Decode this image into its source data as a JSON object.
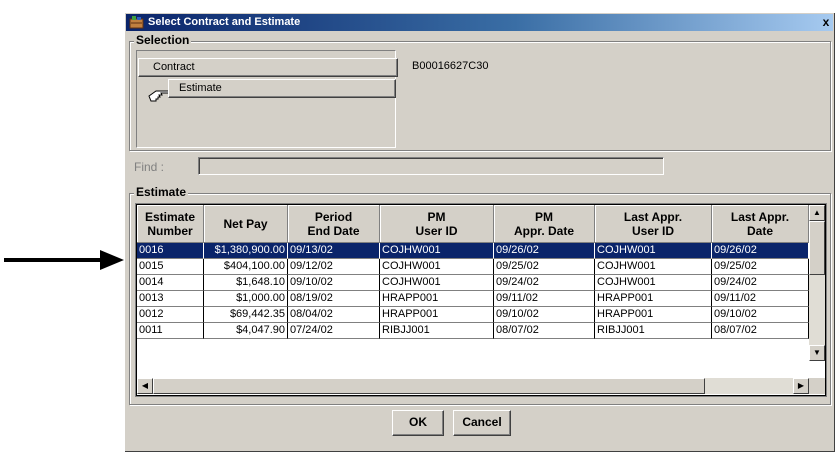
{
  "dialog": {
    "title": "Select Contract and Estimate",
    "close_label": "x"
  },
  "selection": {
    "group_label": "Selection",
    "contract_button": "Contract",
    "contract_value": "B00016627C30",
    "estimate_button": "Estimate"
  },
  "find": {
    "label": "Find :",
    "value": ""
  },
  "estimate_group": {
    "label": "Estimate",
    "columns": [
      {
        "line1": "Estimate",
        "line2": "Number"
      },
      {
        "line1": "Net Pay",
        "line2": ""
      },
      {
        "line1": "Period",
        "line2": "End Date"
      },
      {
        "line1": "PM",
        "line2": "User ID"
      },
      {
        "line1": "PM",
        "line2": "Appr. Date"
      },
      {
        "line1": "Last Appr.",
        "line2": "User ID"
      },
      {
        "line1": "Last Appr.",
        "line2": "Date"
      }
    ],
    "rows": [
      [
        "0016",
        "$1,380,900.00",
        "09/13/02",
        "COJHW001",
        "09/26/02",
        "COJHW001",
        "09/26/02"
      ],
      [
        "0015",
        "$404,100.00",
        "09/12/02",
        "COJHW001",
        "09/25/02",
        "COJHW001",
        "09/25/02"
      ],
      [
        "0014",
        "$1,648.10",
        "09/10/02",
        "COJHW001",
        "09/24/02",
        "COJHW001",
        "09/24/02"
      ],
      [
        "0013",
        "$1,000.00",
        "08/19/02",
        "HRAPP001",
        "09/11/02",
        "HRAPP001",
        "09/11/02"
      ],
      [
        "0012",
        "$69,442.35",
        "08/04/02",
        "HRAPP001",
        "09/10/02",
        "HRAPP001",
        "09/10/02"
      ],
      [
        "0011",
        "$4,047.90",
        "07/24/02",
        "RIBJJ001",
        "08/07/02",
        "RIBJJ001",
        "08/07/02"
      ]
    ]
  },
  "buttons": {
    "ok": "OK",
    "cancel": "Cancel"
  },
  "colors": {
    "selection_bg": "#0a246a",
    "face": "#d4d0c8"
  }
}
